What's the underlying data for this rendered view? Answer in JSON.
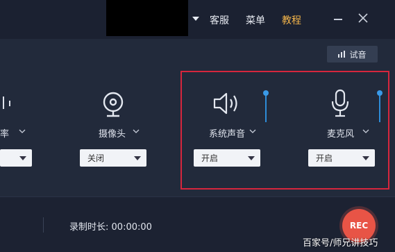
{
  "header": {
    "menu": [
      "客服",
      "菜单",
      "教程"
    ],
    "accent_color": "#f6b64a"
  },
  "toolbar": {
    "test_label": "试音"
  },
  "devices": [
    {
      "label": "率",
      "select_value": ""
    },
    {
      "label": "摄像头",
      "select_value": "关闭"
    },
    {
      "label": "系统声音",
      "select_value": "开启",
      "volume": 1.0
    },
    {
      "label": "麦克风",
      "select_value": "开启",
      "volume": 1.0
    }
  ],
  "status": {
    "duration_label": "录制时长:",
    "duration_value": "00:00:00"
  },
  "record": {
    "label": "REC",
    "color": "#e85446"
  },
  "watermark": {
    "text": "百家号/师兄讲技巧"
  },
  "highlight_color": "#d7263d",
  "icons": {
    "camera": "webcam-icon",
    "speaker": "speaker-icon",
    "mic": "microphone-icon",
    "bars": "audio-bars-icon"
  }
}
